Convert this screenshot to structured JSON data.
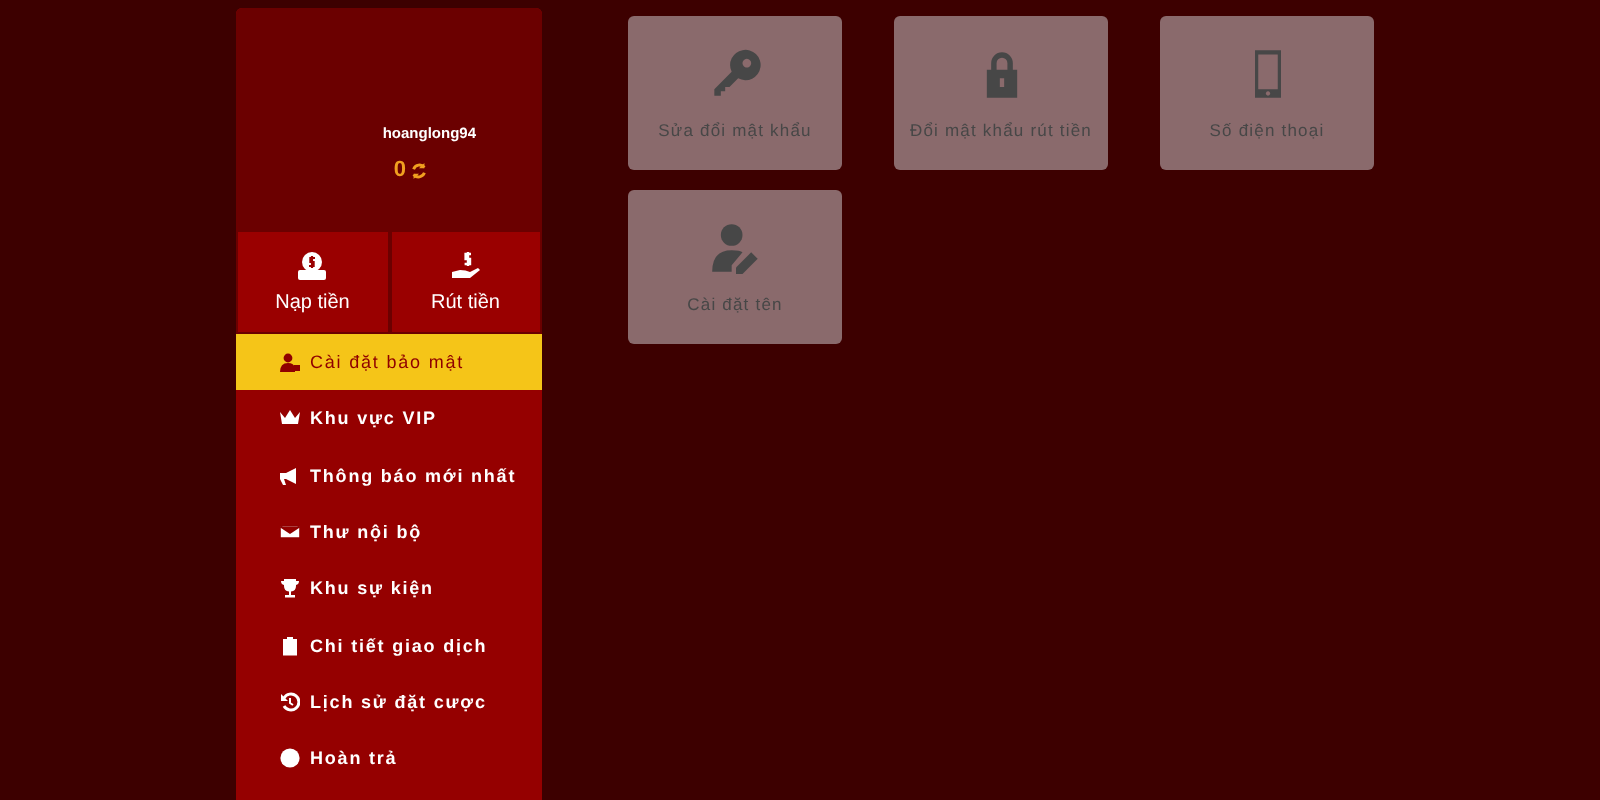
{
  "profile": {
    "username": "hoanglong94",
    "balance": "0"
  },
  "wallet_buttons": [
    {
      "label": "Nạp tiền"
    },
    {
      "label": "Rút tiền"
    }
  ],
  "menu": [
    {
      "label": "Cài đặt bảo mật",
      "selected": true
    },
    {
      "label": "Khu vực VIP",
      "selected": false
    },
    {
      "label": "Thông báo mới nhất",
      "selected": false
    },
    {
      "label": "Thư nội bộ",
      "selected": false
    },
    {
      "label": "Khu sự kiện",
      "selected": false
    },
    {
      "label": "Chi tiết giao dịch",
      "selected": false
    },
    {
      "label": "Lịch sử đặt cược",
      "selected": false
    },
    {
      "label": "Hoàn trả",
      "selected": false
    }
  ],
  "security_options": [
    {
      "label": "Sửa đổi mật khẩu"
    },
    {
      "label": "Đổi mật khẩu rút tiền"
    },
    {
      "label": "Số điện thoại"
    },
    {
      "label": "Cài đặt tên"
    }
  ]
}
